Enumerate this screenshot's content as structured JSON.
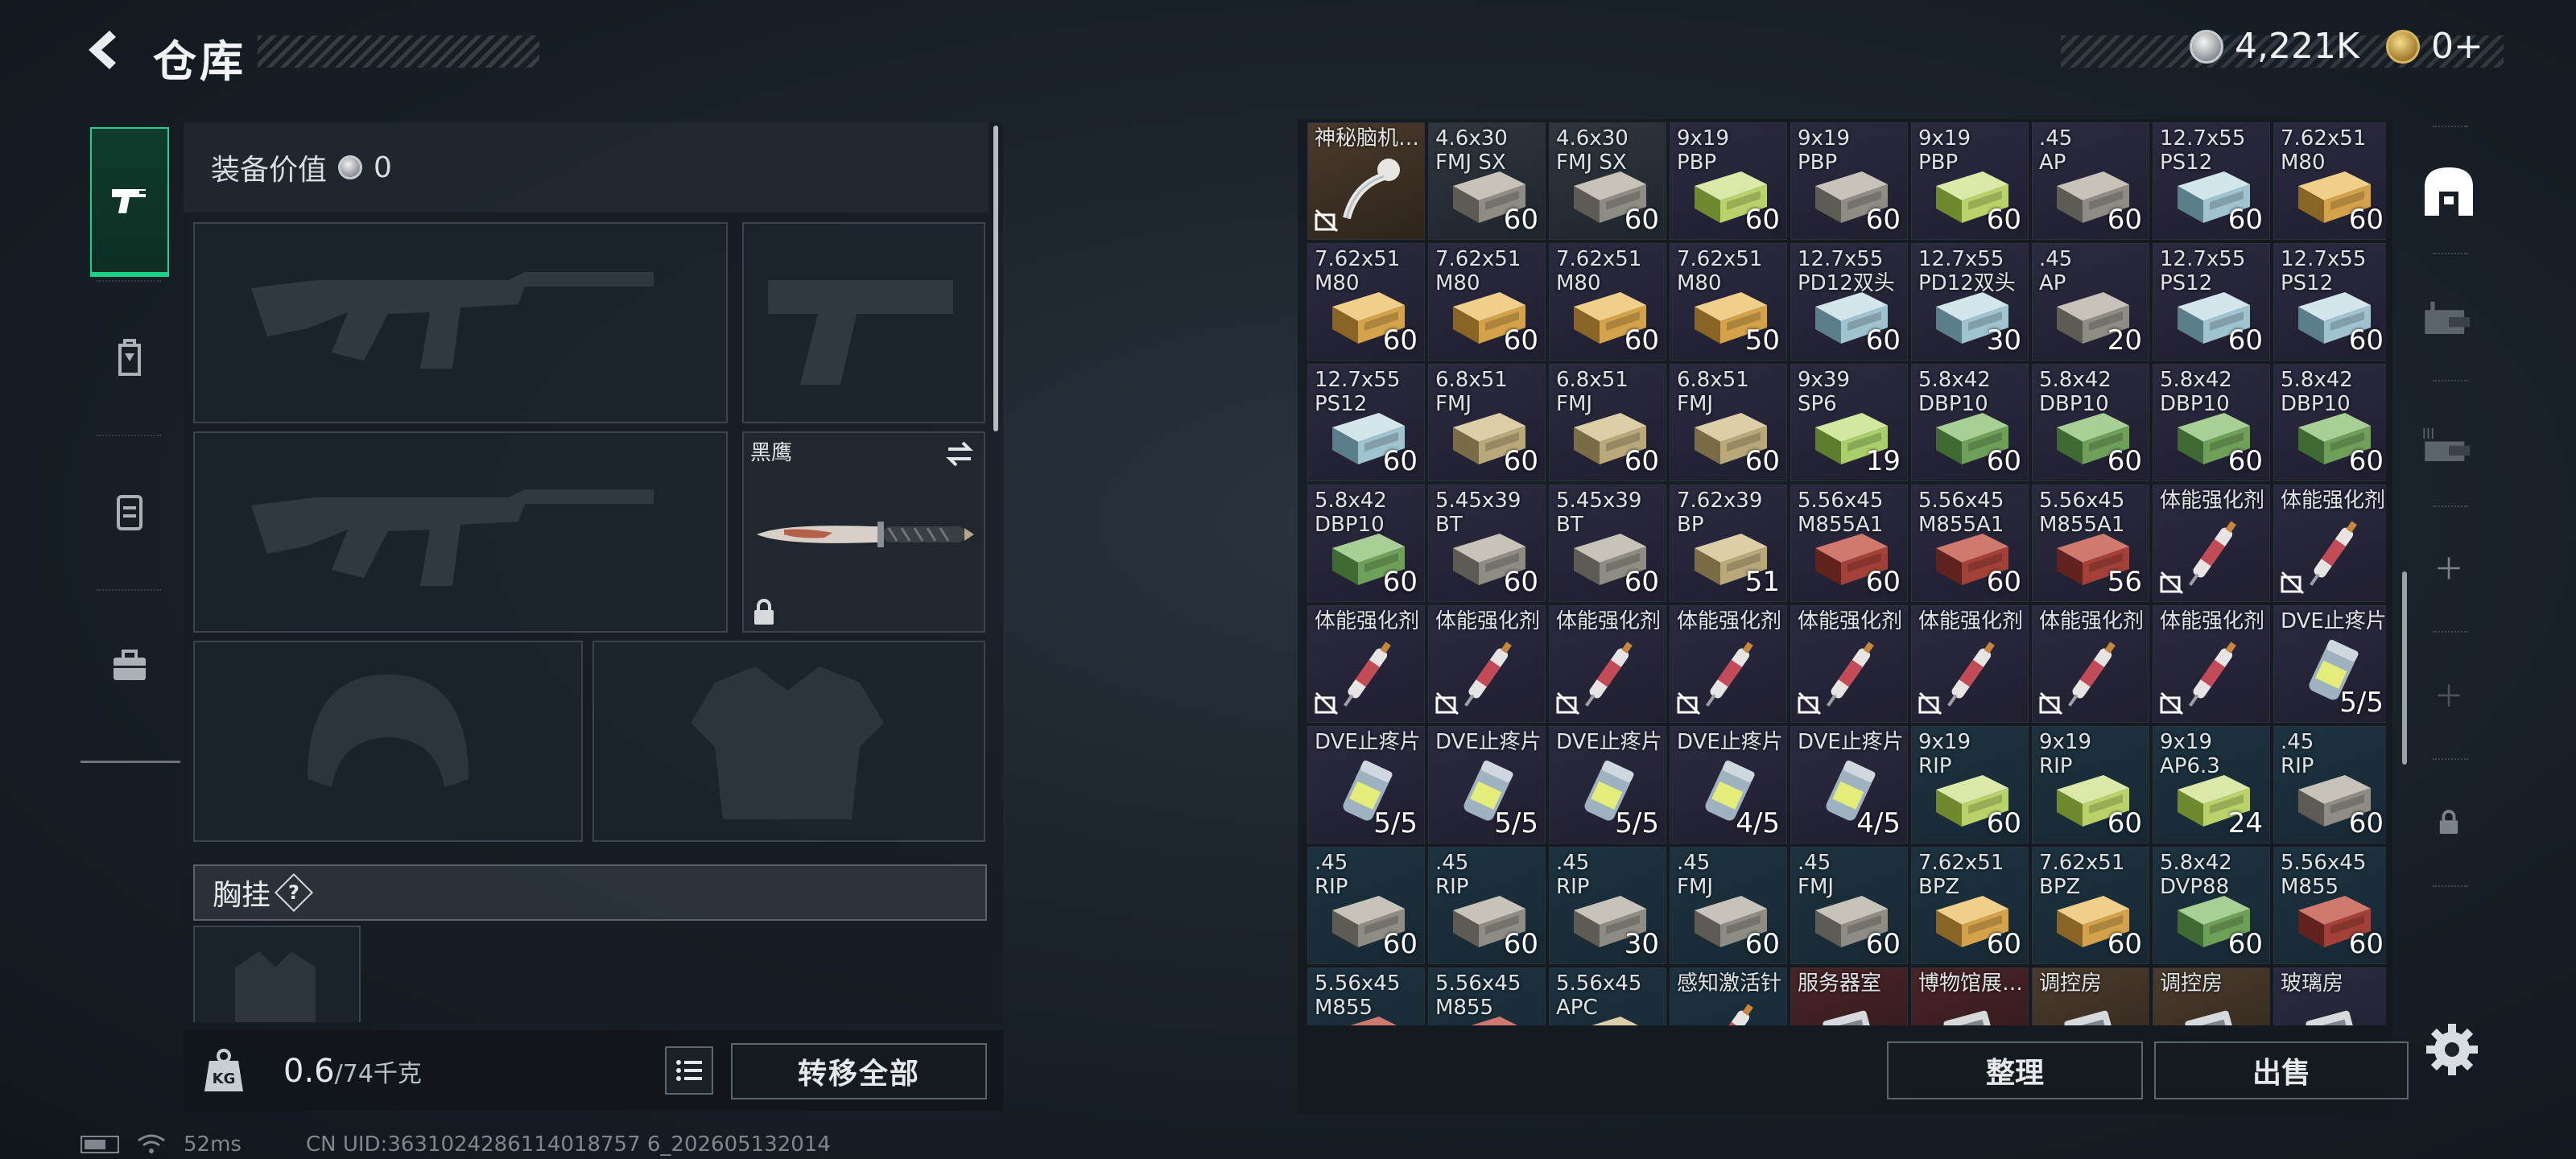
{
  "header": {
    "title": "仓库",
    "silver_amount": "4,221K",
    "gold_amount": "0+"
  },
  "equipment": {
    "value_label": "装备价值",
    "value_amount": "0",
    "melee_name": "黑鹰",
    "chest_rig_label": "胸挂",
    "chest_rig_help": "?",
    "weight_current": "0.6",
    "weight_max": "/74千克",
    "transfer_all_label": "转移全部"
  },
  "status": {
    "ping": "52ms",
    "uid": "CN UID:3631024286114018757 6_202605132014"
  },
  "inventory": {
    "sort_label": "整理",
    "sell_label": "出售",
    "items": [
      {
        "name": "神秘脑机…",
        "qty": "",
        "icon": "probe",
        "bg": "brown",
        "notrade": true
      },
      {
        "name": "4.6x30\nFMJ SX",
        "qty": "60",
        "icon": "ammo-box-gray",
        "bg": "gray"
      },
      {
        "name": "4.6x30\nFMJ SX",
        "qty": "60",
        "icon": "ammo-box-gray",
        "bg": "gray"
      },
      {
        "name": "9x19\nPBP",
        "qty": "60",
        "icon": "ammo-box-green",
        "bg": "purple"
      },
      {
        "name": "9x19\nPBP",
        "qty": "60",
        "icon": "ammo-box-gray",
        "bg": "purple"
      },
      {
        "name": "9x19\nPBP",
        "qty": "60",
        "icon": "ammo-box-green",
        "bg": "purple"
      },
      {
        "name": ".45\nAP",
        "qty": "60",
        "icon": "ammo-box-gray",
        "bg": "purple"
      },
      {
        "name": "12.7x55\nPS12",
        "qty": "60",
        "icon": "ammo-box-blue",
        "bg": "purple"
      },
      {
        "name": "7.62x51\nM80",
        "qty": "60",
        "icon": "ammo-box-tan",
        "bg": "purple"
      },
      {
        "name": "7.62x51\nM80",
        "qty": "60",
        "icon": "ammo-box-tan",
        "bg": "purple"
      },
      {
        "name": "7.62x51\nM80",
        "qty": "60",
        "icon": "ammo-box-tan",
        "bg": "purple"
      },
      {
        "name": "7.62x51\nM80",
        "qty": "60",
        "icon": "ammo-box-tan",
        "bg": "purple"
      },
      {
        "name": "7.62x51\nM80",
        "qty": "50",
        "icon": "ammo-box-tan",
        "bg": "purple"
      },
      {
        "name": "12.7x55\nPD12双头",
        "qty": "60",
        "icon": "ammo-box-blue",
        "bg": "purple"
      },
      {
        "name": "12.7x55\nPD12双头",
        "qty": "30",
        "icon": "ammo-box-blue",
        "bg": "purple"
      },
      {
        "name": ".45\nAP",
        "qty": "20",
        "icon": "ammo-box-gray",
        "bg": "purple"
      },
      {
        "name": "12.7x55\nPS12",
        "qty": "60",
        "icon": "ammo-box-blue",
        "bg": "purple"
      },
      {
        "name": "12.7x55\nPS12",
        "qty": "60",
        "icon": "ammo-box-blue",
        "bg": "purple"
      },
      {
        "name": "12.7x55\nPS12",
        "qty": "60",
        "icon": "ammo-box-blue",
        "bg": "purple"
      },
      {
        "name": "6.8x51\nFMJ",
        "qty": "60",
        "icon": "ammo-box-khaki",
        "bg": "purple"
      },
      {
        "name": "6.8x51\nFMJ",
        "qty": "60",
        "icon": "ammo-box-khaki",
        "bg": "purple"
      },
      {
        "name": "6.8x51\nFMJ",
        "qty": "60",
        "icon": "ammo-box-khaki",
        "bg": "purple"
      },
      {
        "name": "9x39\nSP6",
        "qty": "19",
        "icon": "ammo-box-lime",
        "bg": "purple"
      },
      {
        "name": "5.8x42\nDBP10",
        "qty": "60",
        "icon": "ammo-box-green2",
        "bg": "purple"
      },
      {
        "name": "5.8x42\nDBP10",
        "qty": "60",
        "icon": "ammo-box-green2",
        "bg": "purple"
      },
      {
        "name": "5.8x42\nDBP10",
        "qty": "60",
        "icon": "ammo-box-green2",
        "bg": "purple"
      },
      {
        "name": "5.8x42\nDBP10",
        "qty": "60",
        "icon": "ammo-box-green2",
        "bg": "purple"
      },
      {
        "name": "5.8x42\nDBP10",
        "qty": "60",
        "icon": "ammo-box-green2",
        "bg": "purple"
      },
      {
        "name": "5.45x39\nBT",
        "qty": "60",
        "icon": "ammo-box-gray",
        "bg": "purple"
      },
      {
        "name": "5.45x39\nBT",
        "qty": "60",
        "icon": "ammo-box-gray",
        "bg": "purple"
      },
      {
        "name": "7.62x39\nBP",
        "qty": "51",
        "icon": "ammo-box-khaki",
        "bg": "purple"
      },
      {
        "name": "5.56x45\nM855A1",
        "qty": "60",
        "icon": "ammo-box-red",
        "bg": "purple"
      },
      {
        "name": "5.56x45\nM855A1",
        "qty": "60",
        "icon": "ammo-box-red",
        "bg": "purple"
      },
      {
        "name": "5.56x45\nM855A1",
        "qty": "56",
        "icon": "ammo-box-red",
        "bg": "purple"
      },
      {
        "name": "体能强化剂",
        "qty": "",
        "icon": "injector",
        "bg": "purple",
        "notrade": true
      },
      {
        "name": "体能强化剂",
        "qty": "",
        "icon": "injector",
        "bg": "purple",
        "notrade": true
      },
      {
        "name": "体能强化剂",
        "qty": "",
        "icon": "injector",
        "bg": "purple",
        "notrade": true
      },
      {
        "name": "体能强化剂",
        "qty": "",
        "icon": "injector",
        "bg": "purple",
        "notrade": true
      },
      {
        "name": "体能强化剂",
        "qty": "",
        "icon": "injector",
        "bg": "purple",
        "notrade": true
      },
      {
        "name": "体能强化剂",
        "qty": "",
        "icon": "injector",
        "bg": "purple",
        "notrade": true
      },
      {
        "name": "体能强化剂",
        "qty": "",
        "icon": "injector",
        "bg": "purple",
        "notrade": true
      },
      {
        "name": "体能强化剂",
        "qty": "",
        "icon": "injector",
        "bg": "purple",
        "notrade": true
      },
      {
        "name": "体能强化剂",
        "qty": "",
        "icon": "injector",
        "bg": "purple",
        "notrade": true
      },
      {
        "name": "体能强化剂",
        "qty": "",
        "icon": "injector",
        "bg": "purple",
        "notrade": true
      },
      {
        "name": "DVE止疼片",
        "qty": "5/5",
        "icon": "pill-bottle",
        "bg": "purple"
      },
      {
        "name": "DVE止疼片",
        "qty": "5/5",
        "icon": "pill-bottle",
        "bg": "purple"
      },
      {
        "name": "DVE止疼片",
        "qty": "5/5",
        "icon": "pill-bottle",
        "bg": "purple"
      },
      {
        "name": "DVE止疼片",
        "qty": "5/5",
        "icon": "pill-bottle",
        "bg": "purple"
      },
      {
        "name": "DVE止疼片",
        "qty": "4/5",
        "icon": "pill-bottle",
        "bg": "purple"
      },
      {
        "name": "DVE止疼片",
        "qty": "4/5",
        "icon": "pill-bottle",
        "bg": "purple"
      },
      {
        "name": "9x19\nRIP",
        "qty": "60",
        "icon": "ammo-box-green",
        "bg": "blue"
      },
      {
        "name": "9x19\nRIP",
        "qty": "60",
        "icon": "ammo-box-green",
        "bg": "blue"
      },
      {
        "name": "9x19\nAP6.3",
        "qty": "24",
        "icon": "ammo-box-green",
        "bg": "blue"
      },
      {
        "name": ".45\nRIP",
        "qty": "60",
        "icon": "ammo-box-gray",
        "bg": "blue"
      },
      {
        "name": ".45\nRIP",
        "qty": "60",
        "icon": "ammo-box-gray",
        "bg": "blue"
      },
      {
        "name": ".45\nRIP",
        "qty": "60",
        "icon": "ammo-box-gray",
        "bg": "blue"
      },
      {
        "name": ".45\nRIP",
        "qty": "30",
        "icon": "ammo-box-gray",
        "bg": "blue"
      },
      {
        "name": ".45\nFMJ",
        "qty": "60",
        "icon": "ammo-box-gray",
        "bg": "blue"
      },
      {
        "name": ".45\nFMJ",
        "qty": "60",
        "icon": "ammo-box-gray",
        "bg": "blue"
      },
      {
        "name": "7.62x51\nBPZ",
        "qty": "60",
        "icon": "ammo-box-tan",
        "bg": "blue"
      },
      {
        "name": "7.62x51\nBPZ",
        "qty": "60",
        "icon": "ammo-box-tan",
        "bg": "blue"
      },
      {
        "name": "5.8x42\nDVP88",
        "qty": "60",
        "icon": "ammo-box-green2",
        "bg": "blue"
      },
      {
        "name": "5.56x45\nM855",
        "qty": "60",
        "icon": "ammo-box-red",
        "bg": "blue"
      },
      {
        "name": "5.56x45\nM855",
        "qty": "",
        "icon": "ammo-box-red",
        "bg": "blue"
      },
      {
        "name": "5.56x45\nM855",
        "qty": "",
        "icon": "ammo-box-red",
        "bg": "blue"
      },
      {
        "name": "5.56x45\nAPC",
        "qty": "",
        "icon": "ammo-box-khaki",
        "bg": "blue"
      },
      {
        "name": "感知激活针",
        "qty": "",
        "icon": "injector",
        "bg": "blue"
      },
      {
        "name": "服务器室",
        "qty": "",
        "icon": "keycard",
        "bg": "red"
      },
      {
        "name": "博物馆展…",
        "qty": "",
        "icon": "keycard",
        "bg": "red"
      },
      {
        "name": "调控房",
        "qty": "",
        "icon": "keycard",
        "bg": "brown"
      },
      {
        "name": "调控房",
        "qty": "",
        "icon": "keycard",
        "bg": "brown"
      },
      {
        "name": "玻璃房",
        "qty": "",
        "icon": "keycard",
        "bg": "purple"
      }
    ]
  },
  "colors": {
    "accent_green": "#1fd08a",
    "ammo_green": "#b9d36a",
    "ammo_tan": "#d3a24a",
    "ammo_blue": "#9fc3cf",
    "ammo_red": "#a34138",
    "injector_red": "#c34a57"
  }
}
